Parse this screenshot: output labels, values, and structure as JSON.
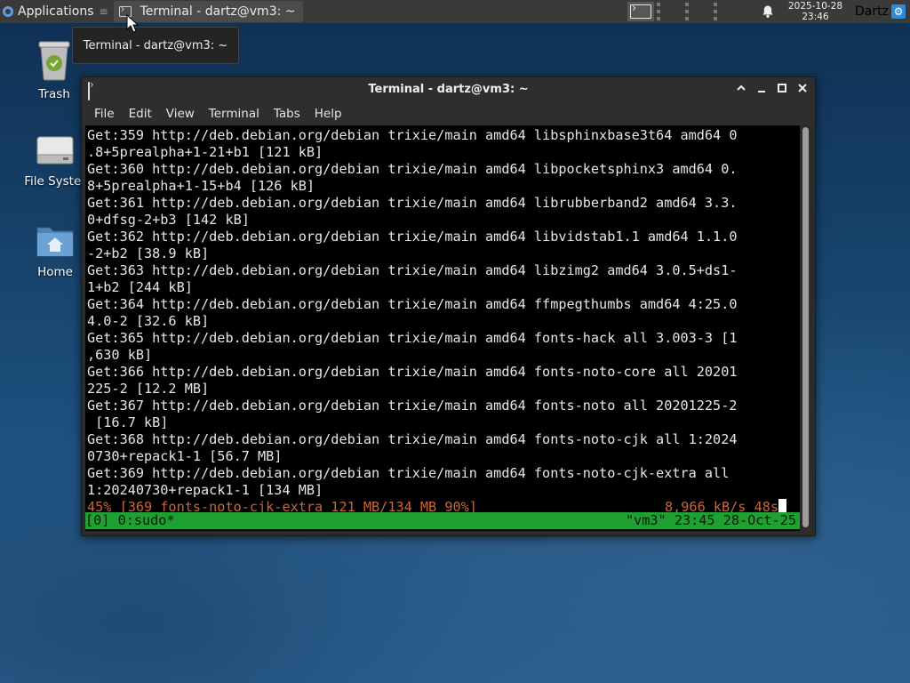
{
  "panel": {
    "applications_label": "Applications",
    "applications_sep": "≡",
    "task_label": "Terminal - dartz@vm3: ~",
    "clock_date": "2025-10-28",
    "clock_time": "23:46",
    "user": "Dartz"
  },
  "tooltip": "Terminal - dartz@vm3: ~",
  "desktop": {
    "icons": [
      {
        "label": "Trash"
      },
      {
        "label": "File Syster"
      },
      {
        "label": "Home"
      }
    ]
  },
  "window": {
    "title": "Terminal - dartz@vm3: ~",
    "menu": [
      "File",
      "Edit",
      "View",
      "Terminal",
      "Tabs",
      "Help"
    ],
    "lines": [
      "Get:359 http://deb.debian.org/debian trixie/main amd64 libsphinxbase3t64 amd64 0",
      ".8+5prealpha+1-21+b1 [121 kB]",
      "Get:360 http://deb.debian.org/debian trixie/main amd64 libpocketsphinx3 amd64 0.",
      "8+5prealpha+1-15+b4 [126 kB]",
      "Get:361 http://deb.debian.org/debian trixie/main amd64 librubberband2 amd64 3.3.",
      "0+dfsg-2+b3 [142 kB]",
      "Get:362 http://deb.debian.org/debian trixie/main amd64 libvidstab1.1 amd64 1.1.0",
      "-2+b2 [38.9 kB]",
      "Get:363 http://deb.debian.org/debian trixie/main amd64 libzimg2 amd64 3.0.5+ds1-",
      "1+b2 [244 kB]",
      "Get:364 http://deb.debian.org/debian trixie/main amd64 ffmpegthumbs amd64 4:25.0",
      "4.0-2 [32.6 kB]",
      "Get:365 http://deb.debian.org/debian trixie/main amd64 fonts-hack all 3.003-3 [1",
      ",630 kB]",
      "Get:366 http://deb.debian.org/debian trixie/main amd64 fonts-noto-core all 20201",
      "225-2 [12.2 MB]",
      "Get:367 http://deb.debian.org/debian trixie/main amd64 fonts-noto all 20201225-2",
      " [16.7 kB]",
      "Get:368 http://deb.debian.org/debian trixie/main amd64 fonts-noto-cjk all 1:2024",
      "0730+repack1-1 [56.7 MB]",
      "Get:369 http://deb.debian.org/debian trixie/main amd64 fonts-noto-cjk-extra all",
      "1:20240730+repack1-1 [134 MB]"
    ],
    "progress_left": "45% [369 fonts-noto-cjk-extra 121 MB/134 MB 90%]",
    "progress_right": "8,966 kB/s 48s",
    "status_left": "[0] 0:sudo*",
    "status_right": "\"vm3\" 23:45 28-Oct-25"
  },
  "colors": {
    "status_bar": "#1fa033",
    "progress_text": "#c8653a",
    "terminal_bg": "#000000"
  }
}
